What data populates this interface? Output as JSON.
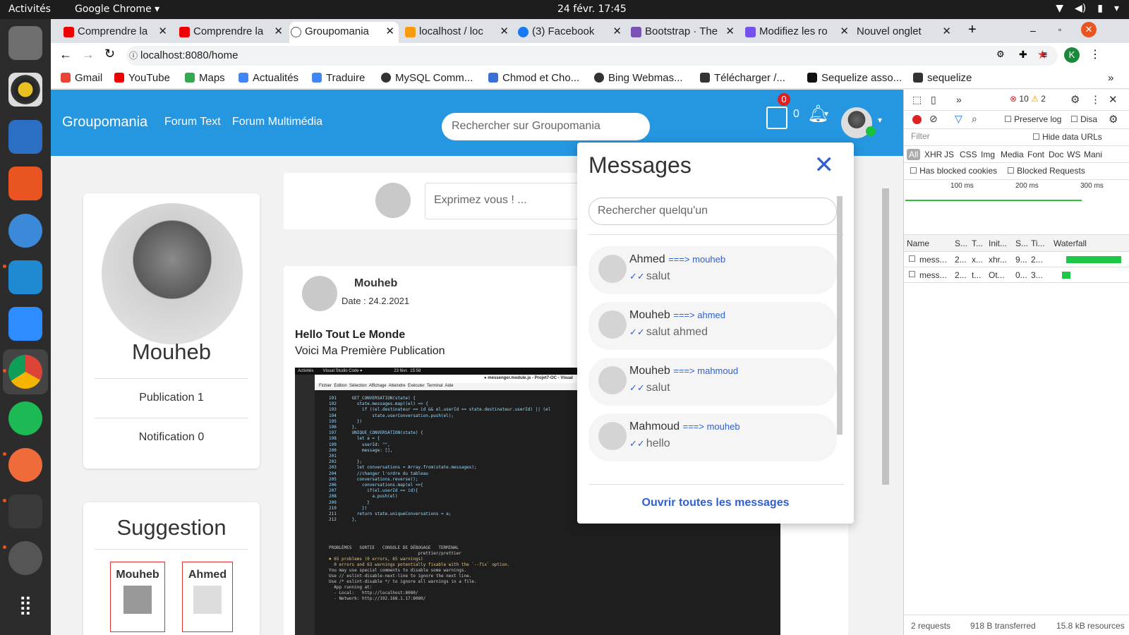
{
  "os": {
    "activities": "Activités",
    "app": "Google Chrome ▾",
    "clock": "24 févr.  17:45"
  },
  "browser": {
    "tabs": [
      {
        "title": "Comprendre la"
      },
      {
        "title": "Comprendre la"
      },
      {
        "title": "Groupomania"
      },
      {
        "title": "localhost / loc"
      },
      {
        "title": "(3) Facebook"
      },
      {
        "title": "Bootstrap · The"
      },
      {
        "title": "Modifiez les ro"
      },
      {
        "title": "Nouvel onglet"
      }
    ],
    "url": "localhost:8080/home",
    "profile_initial": "K",
    "bookmarks": [
      "Gmail",
      "YouTube",
      "Maps",
      "Actualités",
      "Traduire",
      "MySQL Comm...",
      "Chmod et Cho...",
      "Bing Webmas...",
      "Télécharger /...",
      "Sequelize asso...",
      "sequelize"
    ]
  },
  "nav": {
    "brand": "Groupomania",
    "links": [
      "Forum Text",
      "Forum Multimédia"
    ],
    "search_placeholder": "Rechercher sur Groupomania",
    "msg_badge": "0",
    "notif_count": "0"
  },
  "profile": {
    "name": "Mouheb",
    "publication": "Publication 1",
    "notification": "Notification 0"
  },
  "suggestion": {
    "title": "Suggestion",
    "users": [
      "Mouheb",
      "Ahmed"
    ]
  },
  "composer": {
    "placeholder": "Exprimez vous ! ..."
  },
  "post": {
    "author": "Mouheb",
    "date": "Date : 24.2.2021",
    "title": "Hello Tout Le Monde",
    "body": "Voici Ma Première Publication",
    "screenshot_top": "Activités        Visual Studio Code ▾                           23 févr.  15:58",
    "screenshot_title": "● messenger.module.js - Projet7-OC - Visual",
    "screenshot_menu": "Fichier  Edition  Sélection  Affichage  Atteindre  Exécuter  Terminal  Aide",
    "code": [
      "191      GET_CONVERSATION(state) {",
      "192        state.messages.map((el) => {",
      "193          if ((el.destinateur == id && el.userId == state.destinateur.userId) || (el",
      "194              state.userConversation.push(el);",
      "195        })",
      "196      },",
      "197      UNIQUE_CONVERSATION(state) {",
      "198        let a = {",
      "199          userId: \"\",",
      "200          message: [],",
      "201",
      "202        };",
      "203        let conversations = Array.from(state.messages);",
      "204        //changer l'ordre du tableau",
      "205        conversations.reverse();",
      "206          conversations.map(el =>{",
      "207            if(el.userId == id){",
      "208              a.push(el)",
      "209            }",
      "210          })",
      "211        return state.uniqueConversations = a;",
      "212      },"
    ],
    "terminal": [
      "PROBLÈMES   SORTIE   CONSOLE DE DÉBOGAGE   TERMINAL",
      "                                   prettier/prettier",
      "",
      "✖ 65 problems (0 errors, 65 warnings)",
      "  0 errors and 63 warnings potentially fixable with the `--fix` option.",
      "",
      "You may use special comments to disable some warnings.",
      "Use // eslint-disable-next-line to ignore the next line.",
      "Use /* eslint-disable */ to ignore all warnings in a file.",
      "",
      "  App running at:",
      "  - Local:   http://localhost:8080/",
      "  - Network: http://192.168.1.17:8080/"
    ]
  },
  "messages": {
    "title": "Messages",
    "search_placeholder": "Rechercher quelqu'un",
    "items": [
      {
        "name": "Ahmed",
        "to": "===> mouheb",
        "text": "salut"
      },
      {
        "name": "Mouheb",
        "to": "===> ahmed",
        "text": "salut ahmed"
      },
      {
        "name": "Mouheb",
        "to": "===> mahmoud",
        "text": "salut"
      },
      {
        "name": "Mahmoud",
        "to": "===> mouheb",
        "text": "hello"
      }
    ],
    "footer": "Ouvrir toutes les messages"
  },
  "devtools": {
    "errors": "10",
    "warnings": "2",
    "preserve_log": "Preserve log",
    "disable": "Disa",
    "filter_placeholder": "Filter",
    "hide_data_urls": "Hide data URLs",
    "types": [
      "All",
      "XHR",
      "JS",
      "CSS",
      "Img",
      "Media",
      "Font",
      "Doc",
      "WS",
      "Mani"
    ],
    "blocked_cookies": "Has blocked cookies",
    "blocked_requests": "Blocked Requests",
    "timeline_ticks": [
      "100 ms",
      "200 ms",
      "300 ms"
    ],
    "columns": [
      "Name",
      "S...",
      "T...",
      "Init...",
      "S...",
      "Ti...",
      "Waterfall"
    ],
    "rows": [
      [
        "mess...",
        "2...",
        "x...",
        "xhr...",
        "9...",
        "2..."
      ],
      [
        "mess...",
        "2...",
        "t...",
        "Ot...",
        "0...",
        "3..."
      ]
    ],
    "footer": [
      "2 requests",
      "918 B transferred",
      "15.8 kB resources"
    ]
  }
}
